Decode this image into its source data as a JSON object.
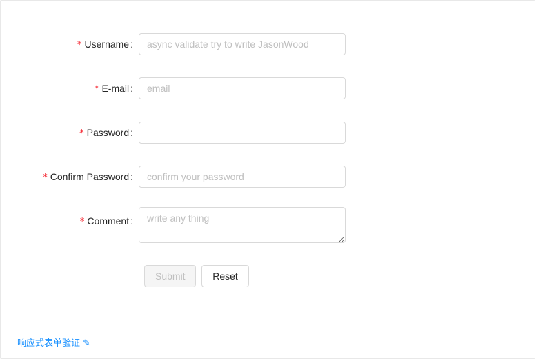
{
  "form": {
    "fields": [
      {
        "label": "Username",
        "required_mark": "*",
        "colon": ":",
        "placeholder": "async validate try to write JasonWood",
        "value": ""
      },
      {
        "label": "E-mail",
        "required_mark": "*",
        "colon": ":",
        "placeholder": "email",
        "value": ""
      },
      {
        "label": "Password",
        "required_mark": "*",
        "colon": ":",
        "placeholder": "",
        "value": ""
      },
      {
        "label": "Confirm Password",
        "required_mark": "*",
        "colon": ":",
        "placeholder": "confirm your password",
        "value": ""
      },
      {
        "label": "Comment",
        "required_mark": "*",
        "colon": ":",
        "placeholder": "write any thing",
        "value": ""
      }
    ],
    "submit_label": "Submit",
    "reset_label": "Reset"
  },
  "footer": {
    "link_text": "响应式表单验证 ✎"
  },
  "colors": {
    "required": "#f5222d",
    "border": "#d9d9d9",
    "link": "#1890ff",
    "disabled_bg": "#f5f5f5"
  }
}
